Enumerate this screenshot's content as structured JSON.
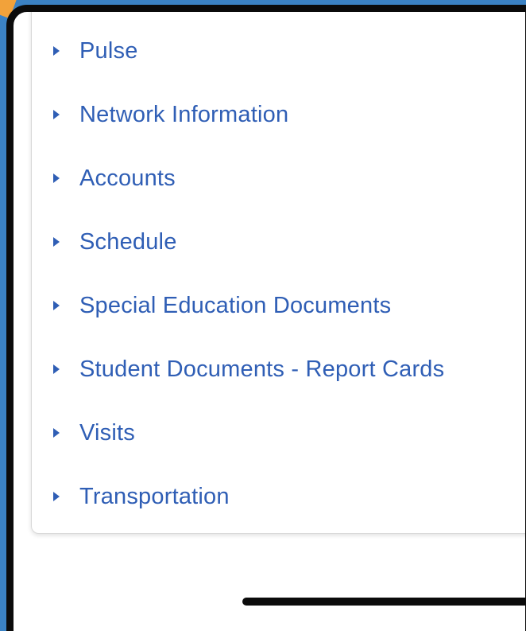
{
  "menu": {
    "items": [
      {
        "label": "Pulse"
      },
      {
        "label": "Network Information"
      },
      {
        "label": "Accounts"
      },
      {
        "label": "Schedule"
      },
      {
        "label": "Special Education Documents"
      },
      {
        "label": "Student Documents - Report Cards"
      },
      {
        "label": "Visits"
      },
      {
        "label": "Transportation"
      }
    ]
  },
  "colors": {
    "link": "#2f5eb5",
    "frame": "#3b82c4",
    "bezel": "#0b0b0b",
    "accent": "#f2a23a"
  },
  "icons": {
    "item_marker": "caret-right-icon"
  }
}
